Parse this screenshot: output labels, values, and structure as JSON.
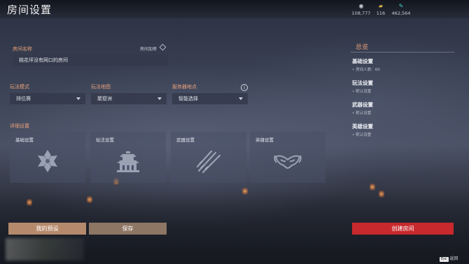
{
  "header": {
    "title": "房间设置",
    "currencies": [
      {
        "icon": "silver-coin-icon",
        "value": "108,777"
      },
      {
        "icon": "gold-ingot-icon",
        "value": "116"
      },
      {
        "icon": "jade-feather-icon",
        "value": "462,564"
      }
    ]
  },
  "room": {
    "name_label": "房间名称",
    "name_value": "桃花坪没有网口的房间",
    "encrypt_label": "房间加密"
  },
  "options": {
    "mode_label": "玩法模式",
    "mode_value": "排位赛",
    "map_label": "玩法地图",
    "map_value": "聚窟洲",
    "server_label": "服务器地点",
    "server_value": "智能选择"
  },
  "details": {
    "label": "详细设置",
    "cards": [
      {
        "title": "基础设置",
        "icon": "basic-settings-icon"
      },
      {
        "title": "玩法设置",
        "icon": "gameplay-settings-icon"
      },
      {
        "title": "武器设置",
        "icon": "weapon-settings-icon"
      },
      {
        "title": "英雄设置",
        "icon": "hero-settings-icon"
      }
    ]
  },
  "summary": {
    "title": "总览",
    "sections": [
      {
        "heading": "基础设置",
        "detail": "房间人数：60"
      },
      {
        "heading": "玩法设置",
        "detail": "默认设置"
      },
      {
        "heading": "武器设置",
        "detail": "默认设置"
      },
      {
        "heading": "英雄设置",
        "detail": "默认设置"
      }
    ]
  },
  "buttons": {
    "preset": "我的预设",
    "save": "保存",
    "create": "创建房间"
  },
  "footer": {
    "esc_key": "Esc",
    "esc_label": "返回"
  },
  "colors": {
    "accent_orange": "#e8a07a",
    "create_red": "#c8292c",
    "preset_tan": "#b58a6c"
  }
}
